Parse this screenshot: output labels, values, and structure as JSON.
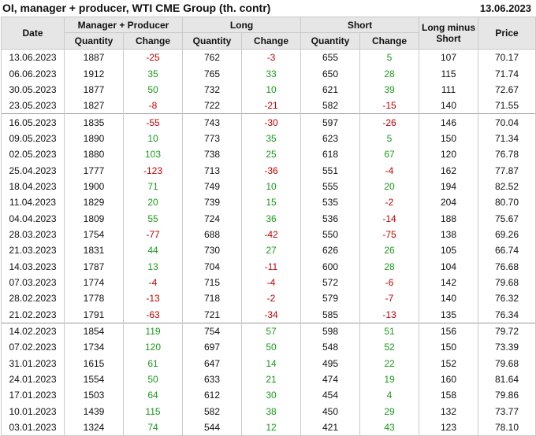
{
  "header": {
    "title": "OI, manager + producer, WTI CME Group (th. contr)",
    "date": "13.06.2023"
  },
  "columns": {
    "date": "Date",
    "mp_group": "Manager + Producer",
    "long_group": "Long",
    "short_group": "Short",
    "long_minus_short": "Long minus Short",
    "price": "Price",
    "quantity": "Quantity",
    "change": "Change"
  },
  "rows": [
    {
      "date": "13.06.2023",
      "mp_q": "1887",
      "mp_c": "-25",
      "l_q": "762",
      "l_c": "-3",
      "s_q": "655",
      "s_c": "5",
      "lms": "107",
      "price": "70.17"
    },
    {
      "date": "06.06.2023",
      "mp_q": "1912",
      "mp_c": "35",
      "l_q": "765",
      "l_c": "33",
      "s_q": "650",
      "s_c": "28",
      "lms": "115",
      "price": "71.74"
    },
    {
      "date": "30.05.2023",
      "mp_q": "1877",
      "mp_c": "50",
      "l_q": "732",
      "l_c": "10",
      "s_q": "621",
      "s_c": "39",
      "lms": "111",
      "price": "72.67"
    },
    {
      "date": "23.05.2023",
      "mp_q": "1827",
      "mp_c": "-8",
      "l_q": "722",
      "l_c": "-21",
      "s_q": "582",
      "s_c": "-15",
      "lms": "140",
      "price": "71.55"
    },
    {
      "date": "16.05.2023",
      "mp_q": "1835",
      "mp_c": "-55",
      "l_q": "743",
      "l_c": "-30",
      "s_q": "597",
      "s_c": "-26",
      "lms": "146",
      "price": "70.04"
    },
    {
      "date": "09.05.2023",
      "mp_q": "1890",
      "mp_c": "10",
      "l_q": "773",
      "l_c": "35",
      "s_q": "623",
      "s_c": "5",
      "lms": "150",
      "price": "71.34"
    },
    {
      "date": "02.05.2023",
      "mp_q": "1880",
      "mp_c": "103",
      "l_q": "738",
      "l_c": "25",
      "s_q": "618",
      "s_c": "67",
      "lms": "120",
      "price": "76.78"
    },
    {
      "date": "25.04.2023",
      "mp_q": "1777",
      "mp_c": "-123",
      "l_q": "713",
      "l_c": "-36",
      "s_q": "551",
      "s_c": "-4",
      "lms": "162",
      "price": "77.87"
    },
    {
      "date": "18.04.2023",
      "mp_q": "1900",
      "mp_c": "71",
      "l_q": "749",
      "l_c": "10",
      "s_q": "555",
      "s_c": "20",
      "lms": "194",
      "price": "82.52"
    },
    {
      "date": "11.04.2023",
      "mp_q": "1829",
      "mp_c": "20",
      "l_q": "739",
      "l_c": "15",
      "s_q": "535",
      "s_c": "-2",
      "lms": "204",
      "price": "80.70"
    },
    {
      "date": "04.04.2023",
      "mp_q": "1809",
      "mp_c": "55",
      "l_q": "724",
      "l_c": "36",
      "s_q": "536",
      "s_c": "-14",
      "lms": "188",
      "price": "75.67"
    },
    {
      "date": "28.03.2023",
      "mp_q": "1754",
      "mp_c": "-77",
      "l_q": "688",
      "l_c": "-42",
      "s_q": "550",
      "s_c": "-75",
      "lms": "138",
      "price": "69.26"
    },
    {
      "date": "21.03.2023",
      "mp_q": "1831",
      "mp_c": "44",
      "l_q": "730",
      "l_c": "27",
      "s_q": "626",
      "s_c": "26",
      "lms": "105",
      "price": "66.74"
    },
    {
      "date": "14.03.2023",
      "mp_q": "1787",
      "mp_c": "13",
      "l_q": "704",
      "l_c": "-11",
      "s_q": "600",
      "s_c": "28",
      "lms": "104",
      "price": "76.68"
    },
    {
      "date": "07.03.2023",
      "mp_q": "1774",
      "mp_c": "-4",
      "l_q": "715",
      "l_c": "-4",
      "s_q": "572",
      "s_c": "-6",
      "lms": "142",
      "price": "79.68"
    },
    {
      "date": "28.02.2023",
      "mp_q": "1778",
      "mp_c": "-13",
      "l_q": "718",
      "l_c": "-2",
      "s_q": "579",
      "s_c": "-7",
      "lms": "140",
      "price": "76.32"
    },
    {
      "date": "21.02.2023",
      "mp_q": "1791",
      "mp_c": "-63",
      "l_q": "721",
      "l_c": "-34",
      "s_q": "585",
      "s_c": "-13",
      "lms": "135",
      "price": "76.34"
    },
    {
      "date": "14.02.2023",
      "mp_q": "1854",
      "mp_c": "119",
      "l_q": "754",
      "l_c": "57",
      "s_q": "598",
      "s_c": "51",
      "lms": "156",
      "price": "79.72"
    },
    {
      "date": "07.02.2023",
      "mp_q": "1734",
      "mp_c": "120",
      "l_q": "697",
      "l_c": "50",
      "s_q": "548",
      "s_c": "52",
      "lms": "150",
      "price": "73.39"
    },
    {
      "date": "31.01.2023",
      "mp_q": "1615",
      "mp_c": "61",
      "l_q": "647",
      "l_c": "14",
      "s_q": "495",
      "s_c": "22",
      "lms": "152",
      "price": "79.68"
    },
    {
      "date": "24.01.2023",
      "mp_q": "1554",
      "mp_c": "50",
      "l_q": "633",
      "l_c": "21",
      "s_q": "474",
      "s_c": "19",
      "lms": "160",
      "price": "81.64"
    },
    {
      "date": "17.01.2023",
      "mp_q": "1503",
      "mp_c": "64",
      "l_q": "612",
      "l_c": "30",
      "s_q": "454",
      "s_c": "4",
      "lms": "158",
      "price": "79.86"
    },
    {
      "date": "10.01.2023",
      "mp_q": "1439",
      "mp_c": "115",
      "l_q": "582",
      "l_c": "38",
      "s_q": "450",
      "s_c": "29",
      "lms": "132",
      "price": "73.77"
    },
    {
      "date": "03.01.2023",
      "mp_q": "1324",
      "mp_c": "74",
      "l_q": "544",
      "l_c": "12",
      "s_q": "421",
      "s_c": "43",
      "lms": "123",
      "price": "78.10"
    }
  ],
  "separator_after_rows": [
    3,
    16
  ],
  "colors": {
    "negative": "#c00000",
    "positive": "#1a9a1a",
    "header_bg": "#e6e6e6"
  }
}
